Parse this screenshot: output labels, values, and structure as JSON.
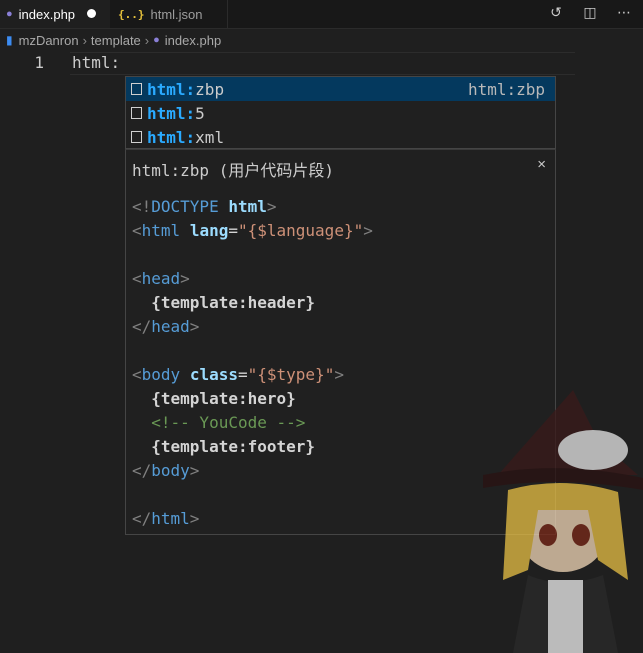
{
  "tabs": [
    {
      "label": "index.php",
      "icon": "php-elephant-icon",
      "modified": true
    },
    {
      "label": "html.json",
      "icon": "json-braces-icon"
    }
  ],
  "tab_actions": [
    "compare-changes-icon",
    "split-editor-icon",
    "more-actions-icon"
  ],
  "breadcrumb": [
    "mzDanron",
    "template",
    "index.php"
  ],
  "editor": {
    "line_number": "1",
    "line_text": "html:"
  },
  "suggestions": [
    {
      "prefix": "html:",
      "rest": "zbp",
      "detail": "html:zbp",
      "selected": true
    },
    {
      "prefix": "html:",
      "rest": "5"
    },
    {
      "prefix": "html:",
      "rest": "xml"
    }
  ],
  "details": {
    "title": "html:zbp (用户代码片段)",
    "close": "×",
    "code": {
      "doctype": {
        "open": "<!",
        "name": "DOCTYPE",
        "kw": "html",
        "close": ">"
      },
      "html_open": {
        "open": "<",
        "tag": "html",
        "attr": "lang",
        "eq": "=",
        "value": "\"{$language}\"",
        "close": ">"
      },
      "head_open": {
        "open": "<",
        "tag": "head",
        "close": ">"
      },
      "header_line": "  {template:header}",
      "head_close": {
        "open": "</",
        "tag": "head",
        "close": ">"
      },
      "body_open": {
        "open": "<",
        "tag": "body",
        "attr": "class",
        "eq": "=",
        "value": "\"{$type}\"",
        "close": ">"
      },
      "hero_line": "  {template:hero}",
      "comment_line": "  <!-- YouCode -->",
      "footer_line": "  {template:footer}",
      "body_close": {
        "open": "</",
        "tag": "body",
        "close": ">"
      },
      "html_close": {
        "open": "</",
        "tag": "html",
        "close": ">"
      }
    }
  },
  "colors": {
    "background": "#1f1f1f",
    "selection": "#04395e",
    "highlight": "#2aaaff",
    "tag": "#569cd6",
    "attribute": "#9cdcfe",
    "string": "#ce9178",
    "comment": "#6a9955"
  }
}
